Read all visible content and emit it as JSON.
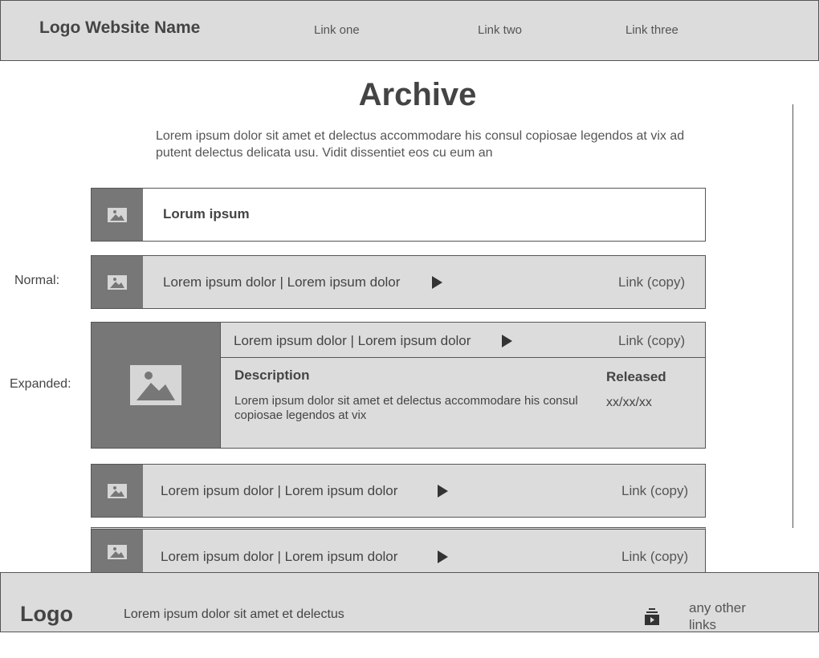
{
  "header": {
    "brand": "Logo Website Name",
    "links": [
      "Link one",
      "Link two",
      "Link three"
    ]
  },
  "page": {
    "title": "Archive",
    "intro": "Lorem ipsum dolor sit amet et delectus accommodare his consul copiosae legendos at vix ad putent delectus delicata usu. Vidit dissentiet eos cu eum an"
  },
  "labels": {
    "normal": "Normal:",
    "expanded": "Expanded:"
  },
  "list": {
    "header_row": {
      "title": "Lorum ipsum",
      "icon": "image-icon"
    },
    "normal_row": {
      "title": "Lorem ipsum dolor | Lorem ipsum dolor",
      "link": "Link (copy)",
      "icon": "image-icon"
    },
    "expanded_row": {
      "title": "Lorem ipsum dolor | Lorem ipsum dolor",
      "link": "Link (copy)",
      "description_heading": "Description",
      "description": "Lorem ipsum dolor sit amet et delectus accommodare his consul copiosae legendos at vix",
      "released_heading": "Released",
      "released_value": "xx/xx/xx",
      "icon": "image-icon"
    },
    "rows": [
      {
        "title": "Lorem ipsum dolor | Lorem ipsum dolor",
        "link": "Link (copy)"
      },
      {
        "title": "Lorem ipsum dolor | Lorem ipsum dolor",
        "link": "Link (copy)"
      }
    ]
  },
  "footer": {
    "logo": "Logo",
    "text": "Lorem ipsum dolor sit amet et delectus",
    "icon": "link-icon",
    "links": "any other links"
  },
  "colors": {
    "panel": "#dcdcdc",
    "thumb": "#777777",
    "border": "#555555",
    "text": "#444444"
  }
}
